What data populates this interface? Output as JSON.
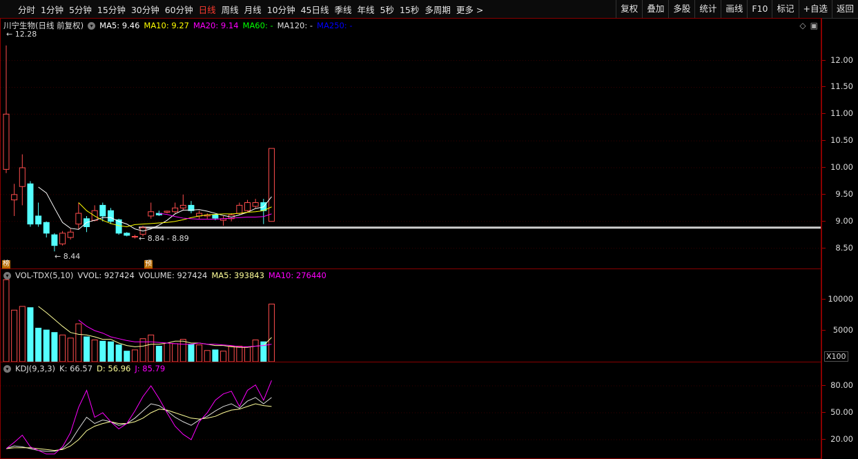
{
  "toolbar": {
    "periods": [
      "分时",
      "1分钟",
      "5分钟",
      "15分钟",
      "30分钟",
      "60分钟",
      "日线",
      "周线",
      "月线",
      "10分钟",
      "45日线",
      "季线",
      "年线",
      "5秒",
      "15秒",
      "多周期",
      "更多 >"
    ],
    "active": "日线",
    "right_buttons": [
      "复权",
      "叠加",
      "多股",
      "统计",
      "画线",
      "F10",
      "标记",
      "+自选",
      "返回"
    ]
  },
  "price_panel": {
    "title": "川宁生物(日线 前复权)",
    "ma": [
      {
        "label": "MA5: 9.46",
        "color": "#ffffff"
      },
      {
        "label": "MA10: 9.27",
        "color": "#ffff00"
      },
      {
        "label": "MA20: 9.14",
        "color": "#ff00ff"
      },
      {
        "label": "MA60: -",
        "color": "#00ff00"
      },
      {
        "label": "MA120: -",
        "color": "#dddddd"
      },
      {
        "label": "MA250: -",
        "color": "#0000ff"
      }
    ],
    "high_label": "12.28",
    "low_label": "8.44",
    "range_label": "8.84 - 8.89",
    "badge1": "榜",
    "badge2": "预",
    "axis": [
      "12.00",
      "11.50",
      "11.00",
      "10.50",
      "10.00",
      "9.50",
      "9.00",
      "8.50"
    ]
  },
  "vol_panel": {
    "items": [
      {
        "label": "VOL-TDX(5,10)",
        "color": "#dddddd"
      },
      {
        "label": "VVOL: 927424",
        "color": "#dddddd"
      },
      {
        "label": "VOLUME: 927424",
        "color": "#dddddd"
      },
      {
        "label": "MA5: 393843",
        "color": "#ffff99"
      },
      {
        "label": "MA10: 276440",
        "color": "#ff00ff"
      }
    ],
    "axis": [
      "10000",
      "5000"
    ],
    "unit": "X100"
  },
  "kdj_panel": {
    "items": [
      {
        "label": "KDJ(9,3,3)",
        "color": "#dddddd"
      },
      {
        "label": "K: 66.57",
        "color": "#dddddd"
      },
      {
        "label": "D: 56.96",
        "color": "#ffff99"
      },
      {
        "label": "J: 85.79",
        "color": "#ff00ff"
      }
    ],
    "axis": [
      "80.00",
      "50.00",
      "20.00"
    ]
  },
  "colors": {
    "up": "#ff4d4d",
    "down": "#54ffff",
    "border": "#8b0000"
  },
  "chart_data": {
    "type": "candlestick",
    "candles": [
      {
        "o": 9.97,
        "c": 11.0,
        "h": 12.28,
        "l": 9.9
      },
      {
        "o": 9.4,
        "c": 9.5,
        "h": 9.7,
        "l": 9.1
      },
      {
        "o": 9.65,
        "c": 10.0,
        "h": 10.25,
        "l": 9.3
      },
      {
        "o": 9.7,
        "c": 8.95,
        "h": 9.75,
        "l": 8.9
      },
      {
        "o": 9.1,
        "c": 8.95,
        "h": 9.35,
        "l": 8.9
      },
      {
        "o": 8.98,
        "c": 8.78,
        "h": 9.0,
        "l": 8.7
      },
      {
        "o": 8.75,
        "c": 8.55,
        "h": 8.78,
        "l": 8.44
      },
      {
        "o": 8.58,
        "c": 8.78,
        "h": 8.82,
        "l": 8.55
      },
      {
        "o": 8.7,
        "c": 8.8,
        "h": 8.86,
        "l": 8.66
      },
      {
        "o": 8.95,
        "c": 9.15,
        "h": 9.35,
        "l": 8.85
      },
      {
        "o": 9.05,
        "c": 8.9,
        "h": 9.1,
        "l": 8.8
      },
      {
        "o": 9.02,
        "c": 9.2,
        "h": 9.3,
        "l": 9.0
      },
      {
        "o": 9.3,
        "c": 9.1,
        "h": 9.35,
        "l": 9.0
      },
      {
        "o": 9.2,
        "c": 9.0,
        "h": 9.25,
        "l": 8.95
      },
      {
        "o": 9.03,
        "c": 8.78,
        "h": 9.05,
        "l": 8.75
      },
      {
        "o": 8.78,
        "c": 8.74,
        "h": 8.8,
        "l": 8.72
      },
      {
        "o": 8.72,
        "c": 8.72,
        "h": 8.75,
        "l": 8.68
      },
      {
        "o": 8.76,
        "c": 8.88,
        "h": 8.92,
        "l": 8.72
      },
      {
        "o": 9.1,
        "c": 9.18,
        "h": 9.35,
        "l": 9.05
      },
      {
        "o": 9.15,
        "c": 9.12,
        "h": 9.2,
        "l": 9.1
      },
      {
        "o": 9.17,
        "c": 9.19,
        "h": 9.2,
        "l": 9.15
      },
      {
        "o": 9.18,
        "c": 9.25,
        "h": 9.35,
        "l": 9.15
      },
      {
        "o": 9.25,
        "c": 9.3,
        "h": 9.5,
        "l": 9.2
      },
      {
        "o": 9.3,
        "c": 9.2,
        "h": 9.38,
        "l": 9.15
      },
      {
        "o": 9.1,
        "c": 9.15,
        "h": 9.2,
        "l": 9.05
      },
      {
        "o": 9.1,
        "c": 9.12,
        "h": 9.15,
        "l": 9.05
      },
      {
        "o": 9.12,
        "c": 9.06,
        "h": 9.14,
        "l": 9.02
      },
      {
        "o": 9.02,
        "c": 9.05,
        "h": 9.1,
        "l": 8.92
      },
      {
        "o": 9.05,
        "c": 9.12,
        "h": 9.15,
        "l": 9.0
      },
      {
        "o": 9.15,
        "c": 9.3,
        "h": 9.35,
        "l": 9.12
      },
      {
        "o": 9.2,
        "c": 9.35,
        "h": 9.4,
        "l": 9.18
      },
      {
        "o": 9.28,
        "c": 9.35,
        "h": 9.42,
        "l": 9.25
      },
      {
        "o": 9.35,
        "c": 9.2,
        "h": 9.42,
        "l": 8.95
      },
      {
        "o": 9.0,
        "c": 10.36,
        "h": 10.36,
        "l": 9.0
      }
    ],
    "ma5": [
      null,
      null,
      null,
      null,
      9.64,
      9.53,
      9.25,
      8.98,
      8.87,
      8.85,
      8.98,
      9.02,
      9.07,
      9.07,
      9.0,
      8.95,
      8.86,
      8.82,
      8.86,
      8.93,
      9.02,
      9.14,
      9.21,
      9.21,
      9.22,
      9.19,
      9.15,
      9.11,
      9.08,
      9.12,
      9.17,
      9.24,
      9.27,
      9.46
    ],
    "ma10": [
      null,
      null,
      null,
      null,
      null,
      null,
      null,
      null,
      null,
      9.35,
      9.2,
      9.1,
      9.02,
      8.96,
      8.92,
      8.9,
      8.94,
      8.95,
      8.96,
      8.97,
      8.98,
      9.0,
      9.03,
      9.07,
      9.1,
      9.12,
      9.13,
      9.14,
      9.14,
      9.15,
      9.17,
      9.18,
      9.2,
      9.27
    ],
    "ma20": [
      null,
      null,
      null,
      null,
      null,
      null,
      null,
      null,
      null,
      null,
      null,
      null,
      null,
      null,
      null,
      null,
      null,
      null,
      null,
      9.15,
      9.13,
      9.09,
      9.06,
      9.05,
      9.04,
      9.04,
      9.04,
      9.05,
      9.06,
      9.07,
      9.08,
      9.08,
      9.09,
      9.14
    ],
    "volume": [
      13200,
      8300,
      8900,
      8700,
      5400,
      5100,
      4700,
      4300,
      3800,
      6100,
      4000,
      3500,
      3300,
      3200,
      2700,
      1700,
      1900,
      3700,
      4300,
      2500,
      3000,
      2900,
      3600,
      2800,
      2700,
      1800,
      1900,
      1700,
      2500,
      2500,
      2400,
      3500,
      3200,
      9274
    ],
    "vol_ma5": [
      null,
      null,
      null,
      null,
      8900,
      7900,
      6800,
      5700,
      4700,
      4400,
      4300,
      4000,
      3600,
      3600,
      3000,
      2600,
      2400,
      2500,
      2800,
      2800,
      3000,
      3300,
      3300,
      3000,
      3000,
      2800,
      2600,
      2600,
      2400,
      2300,
      2300,
      2500,
      2600,
      3900
    ],
    "vol_ma10": [
      null,
      null,
      null,
      null,
      null,
      null,
      null,
      null,
      null,
      6700,
      5700,
      5000,
      4600,
      4000,
      3700,
      3400,
      3200,
      3200,
      3200,
      3100,
      3000,
      2900,
      2800,
      2800,
      3000,
      2800,
      2800,
      2700,
      2600,
      2400,
      2400,
      2500,
      2600,
      2800
    ],
    "kdj_k": [
      10,
      13,
      12,
      10,
      8,
      7,
      7,
      10,
      18,
      32,
      45,
      38,
      42,
      40,
      36,
      38,
      44,
      52,
      60,
      58,
      52,
      45,
      40,
      36,
      42,
      46,
      52,
      57,
      60,
      55,
      63,
      67,
      60,
      67
    ],
    "kdj_d": [
      10,
      11,
      11,
      11,
      10,
      9,
      8,
      9,
      13,
      20,
      30,
      35,
      38,
      40,
      38,
      38,
      40,
      44,
      50,
      54,
      53,
      50,
      47,
      44,
      43,
      44,
      46,
      50,
      53,
      54,
      57,
      60,
      58,
      57
    ],
    "kdj_j": [
      10,
      17,
      25,
      12,
      8,
      4,
      4,
      12,
      28,
      56,
      75,
      45,
      50,
      40,
      32,
      38,
      52,
      68,
      80,
      66,
      50,
      35,
      26,
      20,
      40,
      50,
      64,
      71,
      74,
      57,
      75,
      81,
      64,
      86
    ],
    "price_range": [
      8.25,
      12.6
    ],
    "vol_range": [
      0,
      14000
    ],
    "kdj_range": [
      0,
      100
    ]
  }
}
